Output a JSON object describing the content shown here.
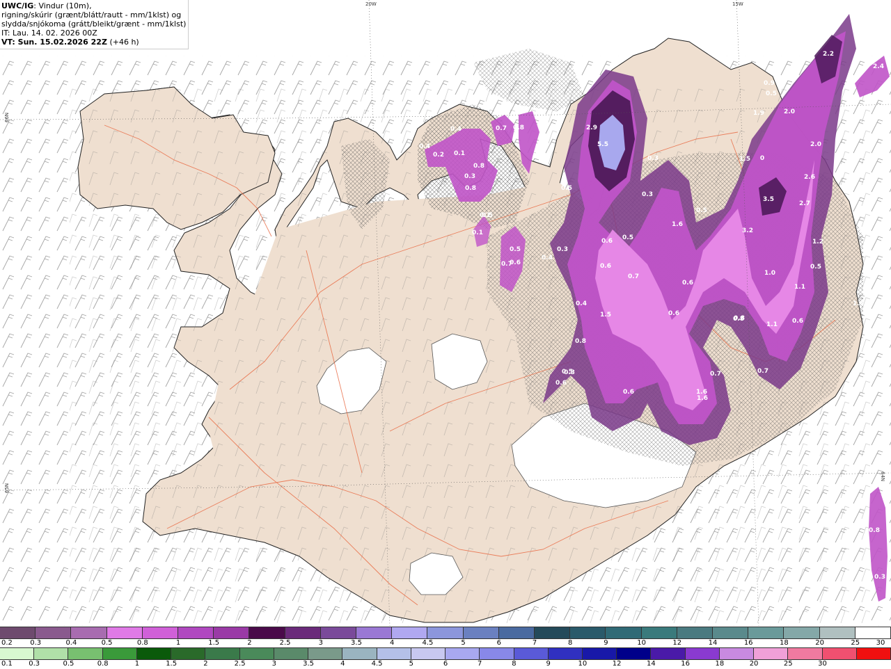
{
  "header": {
    "product": "UWC/IG",
    "desc1": ": Vindur (10m),",
    "desc2": "rigning/skúrir (grænt/blátt/rautt - mm/1klst) og",
    "desc3": "slydda/snjókoma (grátt/bleikt/grænt - mm/1klst)",
    "it": "IT: Lau. 14. 02. 2026 00Z",
    "vt_label": "VT: Sun. 15.02.2026 22Z",
    "vt_lead": "(+46 h)"
  },
  "graticule": {
    "lon_20": "20W",
    "lon_15": "15W",
    "lat_66": "66N",
    "lat_65": "65N",
    "lat_64": "64N"
  },
  "colors": {
    "sea": "#ffffff",
    "land": "#efdfd0",
    "roads": "#e8643c",
    "precip_light": "#e88ae8",
    "precip_mid": "#c054c8",
    "precip_dark": "#7a3a8a",
    "precip_darkest": "#4e1a5a",
    "precip_core": "#a8a8ee"
  },
  "precip_labels": [
    "0.4",
    "0.7",
    "0.8",
    "0.3",
    "0.4",
    "0.2",
    "0.1",
    "0.8",
    "0.1",
    "2.9",
    "5.5",
    "0.3",
    "0.5",
    "0.3",
    "0.1",
    "0.8",
    "0.5",
    "0.7",
    "0.3",
    "0.4",
    "0.6",
    "0.5",
    "0.6",
    "0.7",
    "1.6",
    "0.5",
    "0.6",
    "0.4",
    "1.5",
    "0.6",
    "0.8",
    "1.6",
    "0.5",
    "0.6",
    "1.6",
    "0.6",
    "0.7",
    "0.3",
    "0.8",
    "2.2",
    "0.9",
    "0.5",
    "1.9",
    "2.0",
    "1.5",
    "0",
    "2.0",
    "2.6",
    "3.5",
    "2.7",
    "3.2",
    "1.2",
    "1.0",
    "0.5",
    "1.1",
    "0.8",
    "1.1",
    "0.6",
    "0.7",
    "1.4",
    "2.4",
    "0.8",
    "0.3",
    "0.5",
    "0.6"
  ],
  "legend_snow": {
    "colors": [
      "#6e4a6e",
      "#8a5a8e",
      "#a86cb0",
      "#e07ae6",
      "#d060d8",
      "#b048c0",
      "#9a3aa6",
      "#4a0a4a",
      "#6a2a7a",
      "#7a4a9a",
      "#9a78d4",
      "#b0a8f0",
      "#8c96dc",
      "#6a80c0",
      "#4a6aa0",
      "#244a5a",
      "#2a5a6a",
      "#306a76",
      "#3a7a7c",
      "#4a7a80",
      "#5a8a8c",
      "#6a9a9a",
      "#84a8a8",
      "#b0c0c0",
      "#ffffff"
    ],
    "labels": [
      "0.2",
      "0.3",
      "0.4",
      "0.5",
      "0.8",
      "1",
      "1.5",
      "2",
      "2.5",
      "3",
      "3.5",
      "4",
      "4.5",
      "5",
      "6",
      "7",
      "8",
      "9",
      "10",
      "12",
      "14",
      "16",
      "18",
      "20",
      "25",
      "30"
    ]
  },
  "legend_rain": {
    "colors": [
      "#d8f8d0",
      "#b0e0a8",
      "#78c070",
      "#3a9a3a",
      "#0a5a0a",
      "#2a6a2a",
      "#3a7a4a",
      "#4a8a5a",
      "#5a8a6a",
      "#7a9a8a",
      "#9ab4c0",
      "#b4c0e8",
      "#c8c8f0",
      "#a8a8f0",
      "#8888e8",
      "#5a5ad8",
      "#3030c0",
      "#1818a8",
      "#00008a",
      "#4a1aa8",
      "#8a3ad0",
      "#c88ae0",
      "#f0a0d8",
      "#f07aa0",
      "#f05070",
      "#f01010"
    ],
    "labels": [
      "0.1",
      "0.3",
      "0.5",
      "0.8",
      "1",
      "1.5",
      "2",
      "2.5",
      "3",
      "3.5",
      "4",
      "4.5",
      "5",
      "6",
      "7",
      "8",
      "9",
      "10",
      "12",
      "14",
      "16",
      "18",
      "20",
      "25",
      "30"
    ]
  }
}
